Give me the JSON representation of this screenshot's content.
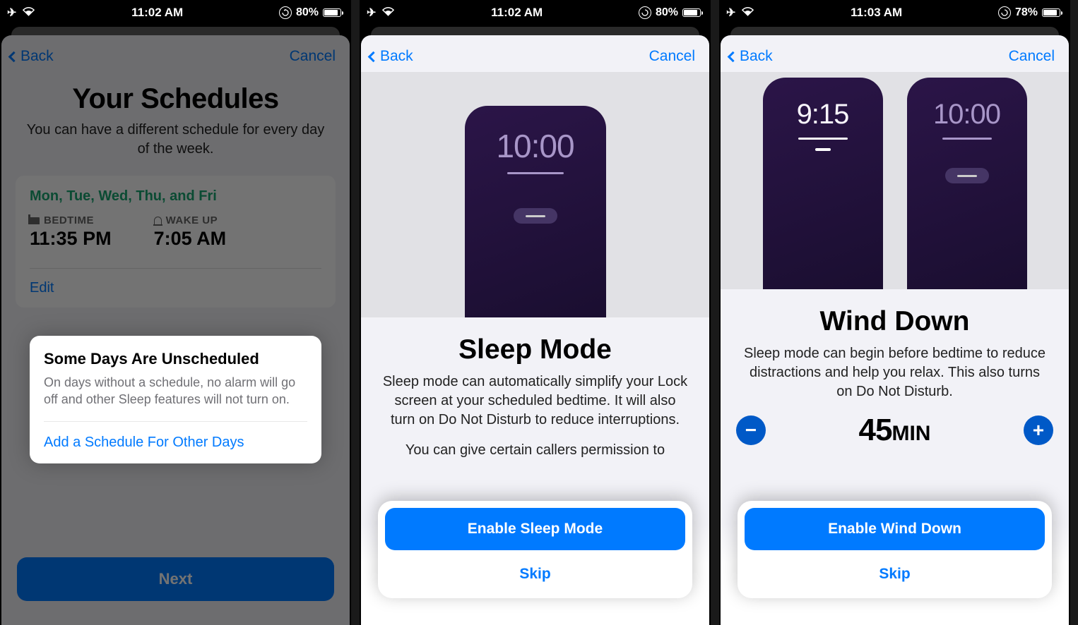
{
  "status": {
    "time_a": "11:02 AM",
    "time_b": "11:02 AM",
    "time_c": "11:03 AM",
    "battery_a": "80%",
    "battery_b": "80%",
    "battery_c": "78%"
  },
  "nav": {
    "back": "Back",
    "cancel": "Cancel"
  },
  "screen1": {
    "title": "Your Schedules",
    "subtitle": "You can have a different schedule for every day of the week.",
    "card": {
      "days": "Mon, Tue, Wed, Thu, and Fri",
      "bedtime_label": "BEDTIME",
      "bedtime_value": "11:35 PM",
      "wakeup_label": "WAKE UP",
      "wakeup_value": "7:05 AM",
      "edit": "Edit"
    },
    "info": {
      "title": "Some Days Are Unscheduled",
      "text": "On days without a schedule, no alarm will go off and other Sleep features will not turn on.",
      "link": "Add a Schedule For Other Days"
    },
    "next": "Next"
  },
  "screen2": {
    "illus_time": "10:00",
    "title": "Sleep Mode",
    "para1": "Sleep mode can automatically simplify your Lock screen at your scheduled bedtime. It will also turn on Do Not Disturb to reduce interruptions.",
    "para2": "You can give certain callers permission to",
    "enable": "Enable Sleep Mode",
    "skip": "Skip"
  },
  "screen3": {
    "illus_time_left": "9:15",
    "illus_time_right": "10:00",
    "title": "Wind Down",
    "para": "Sleep mode can begin before bedtime to reduce distractions and help you relax. This also turns on Do Not Disturb.",
    "counter_value": "45",
    "counter_unit": "MIN",
    "minus": "−",
    "plus": "+",
    "enable": "Enable Wind Down",
    "skip": "Skip"
  }
}
